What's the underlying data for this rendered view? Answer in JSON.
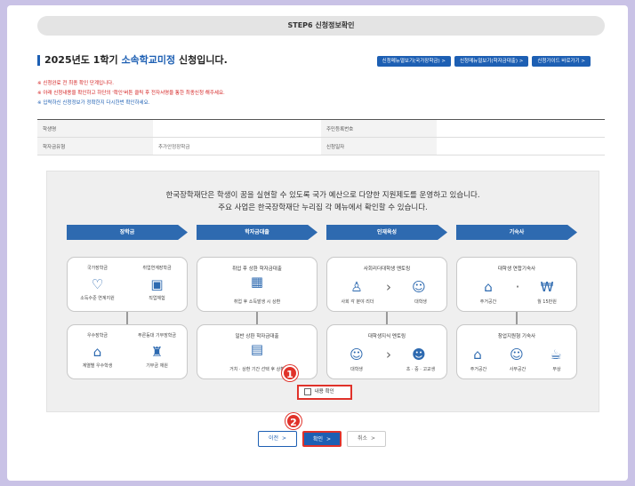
{
  "step_bar": "STEP6 신청정보확인",
  "headline": {
    "year_term": "2025년도 1학기",
    "school": "소속학교미정",
    "suffix": "신청입니다."
  },
  "top_buttons": [
    {
      "label": "신청메뉴얼보기(국가장학금) >"
    },
    {
      "label": "신청메뉴얼보기(학자금대출) >"
    },
    {
      "label": "신청가이드 바로가기 >"
    }
  ],
  "notes": [
    {
      "text": "※ 신청완료 전 최종 확인 단계입니다.",
      "color": "red"
    },
    {
      "text": "※ 아래 신청내용을 확인하고 하단의 '확인'버튼 클릭 후 전자서명을 통한 최종신청 해주세요.",
      "color": "red"
    },
    {
      "text": "※ 입력하신 신청정보가 정확한지 다시한번 확인하세요.",
      "color": "blue"
    }
  ],
  "info_table": [
    {
      "label1": "학생명",
      "value1": "",
      "label2": "주민등록번호",
      "value2": ""
    },
    {
      "label1": "학자금유형",
      "value1": "추가안정장학금",
      "label2": "신청일자",
      "value2": ""
    }
  ],
  "intro": {
    "line1": "한국장학재단은 학생이 꿈을 실현할 수 있도록 국가 예산으로 다양한 지원제도를 운영하고 있습니다.",
    "line2": "주요 사업은 한국장학재단 누리집 각 메뉴에서 확인할 수 있습니다."
  },
  "columns": [
    {
      "header": "장학금",
      "card1": {
        "left_title": "국가장학금",
        "left_sub": "소득수준 연계지원",
        "right_title": "취업연계장학금",
        "right_sub": "직업체험"
      },
      "card2": {
        "left_title": "우수장학금",
        "left_sub": "계열별 우수학생",
        "right_title": "푸른등대 기부장학금",
        "right_sub": "기부금 재원"
      }
    },
    {
      "header": "학자금대출",
      "card1": {
        "title": "취업 후 상환 학자금대출",
        "sub": "취업 후 소득발생 시 상환"
      },
      "card2": {
        "title": "일반 상환 학자금대출",
        "sub": "거치 · 상환 기간 선택 후 상환"
      }
    },
    {
      "header": "인재육성",
      "card1": {
        "title": "사회리더대학생 멘토링",
        "left_sub": "사회 각 분야 리더",
        "right_sub": "대학생"
      },
      "card2": {
        "title": "대학생지식 멘토링",
        "left_sub": "대학생",
        "right_sub": "초 · 중 · 고교생"
      }
    },
    {
      "header": "기숙사",
      "card1": {
        "title": "대학생 연합기숙사",
        "left_sub": "주거공간",
        "right_sub": "월 15만원"
      },
      "card2": {
        "title": "창업지원형 기숙사",
        "left_sub": "주거공간",
        "mid_sub": "사무공간",
        "right_sub": "무상"
      }
    }
  ],
  "confirm_checkbox": "내용 확인",
  "badges": [
    "1",
    "2"
  ],
  "buttons": {
    "prev": "이전",
    "ok": "확인",
    "cancel": "취소",
    "chevron": ">"
  },
  "colors": {
    "accent": "#1d5fb3",
    "highlight": "#e0322a",
    "notice_red": "#d42020"
  }
}
